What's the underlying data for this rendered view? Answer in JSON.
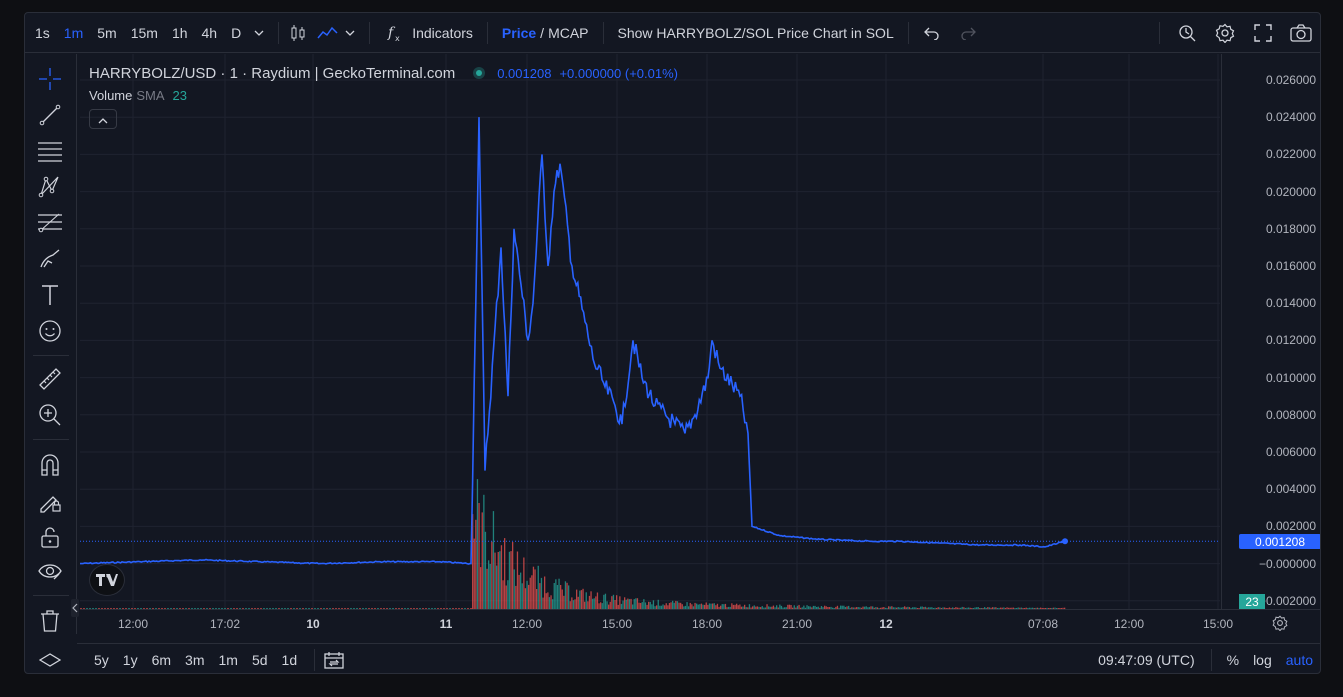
{
  "toolbar": {
    "timeframes": [
      "1s",
      "1m",
      "5m",
      "15m",
      "1h",
      "4h",
      "D"
    ],
    "active_timeframe": "1m",
    "indicators_label": "Indicators",
    "price_label": "Price",
    "slash": "/",
    "mcap_label": "MCAP",
    "show_sol_label": "Show HARRYBOLZ/SOL Price Chart in SOL"
  },
  "legend": {
    "symbol": "HARRYBOLZ/USD · 1 · Raydium | GeckoTerminal.com",
    "last_price": "0.001208",
    "change": "+0.000000 (+0.01%)",
    "volume_label": "Volume",
    "sma_label": "SMA",
    "sma_value": "23"
  },
  "price_axis": {
    "ticks": [
      "0.026000",
      "0.024000",
      "0.022000",
      "0.020000",
      "0.018000",
      "0.016000",
      "0.014000",
      "0.012000",
      "0.010000",
      "0.008000",
      "0.006000",
      "0.004000",
      "0.002000",
      "−0.000000",
      "−0.002000"
    ],
    "last_price_badge": "0.001208",
    "volume_badge": "23"
  },
  "time_axis": {
    "ticks": [
      {
        "label": "12:00",
        "bold": false
      },
      {
        "label": "17:02",
        "bold": false
      },
      {
        "label": "10",
        "bold": true
      },
      {
        "label": "11",
        "bold": true
      },
      {
        "label": "12:00",
        "bold": false
      },
      {
        "label": "15:00",
        "bold": false
      },
      {
        "label": "18:00",
        "bold": false
      },
      {
        "label": "21:00",
        "bold": false
      },
      {
        "label": "12",
        "bold": true
      },
      {
        "label": "07:08",
        "bold": false
      },
      {
        "label": "12:00",
        "bold": false
      },
      {
        "label": "15:00",
        "bold": false
      }
    ]
  },
  "bottom": {
    "ranges": [
      "5y",
      "1y",
      "6m",
      "3m",
      "1m",
      "5d",
      "1d"
    ],
    "clock": "09:47:09 (UTC)",
    "percent_label": "%",
    "log_label": "log",
    "auto_label": "auto"
  },
  "colors": {
    "line": "#2962ff",
    "up_volume": "#26a69a",
    "down_volume": "#ef5350",
    "background": "#131722"
  },
  "chart_data": {
    "type": "line",
    "series": [
      {
        "y": [
          0.0,
          0.0001,
          0.0002,
          0.0001,
          0.0,
          0.0001,
          0.0001,
          0.0,
          0.0,
          0.024,
          0.005,
          0.017,
          0.009,
          0.018,
          0.015,
          0.012,
          0.014,
          0.022,
          0.016,
          0.02,
          0.0215,
          0.016,
          0.013,
          0.011,
          0.0095,
          0.0085,
          0.0075,
          0.012,
          0.01,
          0.0085,
          0.0075,
          0.007,
          0.008,
          0.01,
          0.012,
          0.0105,
          0.009,
          0.007,
          0.002,
          0.0015,
          0.0013,
          0.0012,
          0.0012,
          0.0011,
          0.001,
          0.001,
          0.0009,
          0.0012
        ]
      }
    ],
    "ylim": [
      -0.002,
      0.026
    ]
  }
}
